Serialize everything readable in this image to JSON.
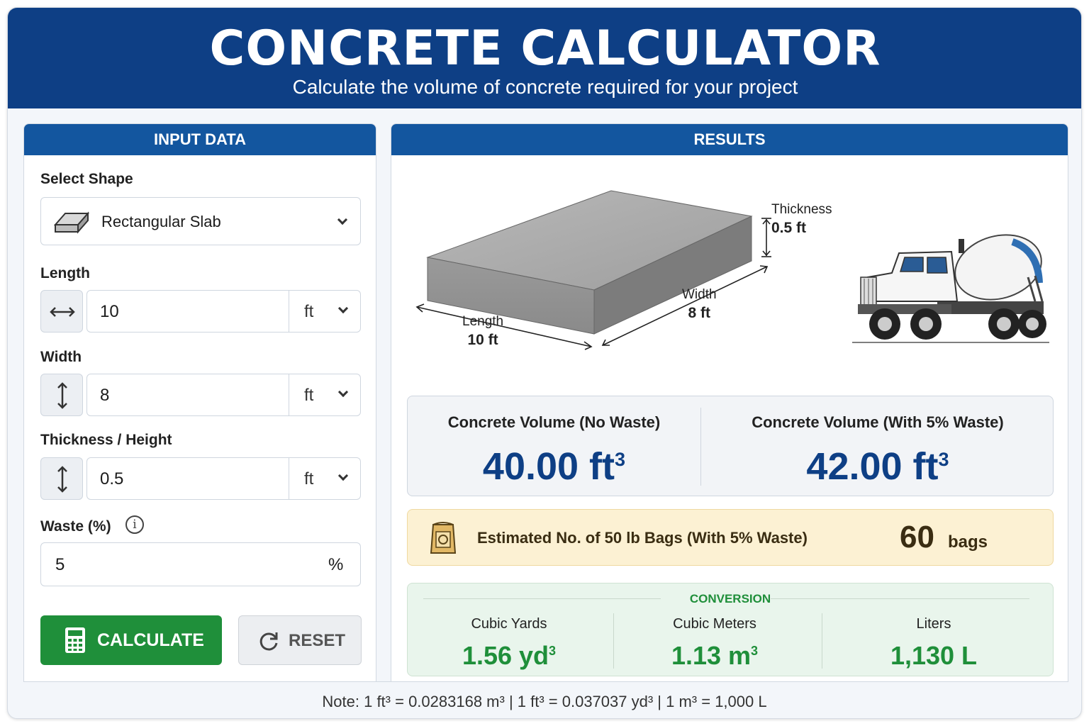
{
  "header": {
    "title": "CONCRETE CALCULATOR",
    "subtitle": "Calculate the volume of concrete required for your project"
  },
  "input_panel": {
    "heading": "INPUT DATA",
    "shape_label": "Select Shape",
    "shape_value": "Rectangular Slab",
    "length": {
      "label": "Length",
      "value": "10",
      "unit": "ft"
    },
    "width": {
      "label": "Width",
      "value": "8",
      "unit": "ft"
    },
    "thickness": {
      "label": "Thickness / Height",
      "value": "0.5",
      "unit": "ft"
    },
    "waste": {
      "label": "Waste (%)",
      "value": "5",
      "unit": "%",
      "info_glyph": "i"
    },
    "calculate_label": "CALCULATE",
    "reset_label": "RESET"
  },
  "results_panel": {
    "heading": "RESULTS",
    "diagram": {
      "thickness_label": "Thickness",
      "thickness_value": "0.5 ft",
      "width_label": "Width",
      "width_value": "8 ft",
      "length_label": "Length",
      "length_value": "10 ft"
    },
    "volume_no_waste": {
      "label": "Concrete Volume (No Waste)",
      "value": "40.00 ft",
      "sup": "3"
    },
    "volume_with_waste": {
      "label": "Concrete Volume (With 5% Waste)",
      "value": "42.00 ft",
      "sup": "3"
    },
    "bags": {
      "label": "Estimated No. of 50 lb Bags (With 5% Waste)",
      "value": "60",
      "unit": "bags"
    },
    "conversion": {
      "title": "CONVERSION",
      "items": [
        {
          "label": "Cubic Yards",
          "value": "1.56 yd",
          "sup": "3"
        },
        {
          "label": "Cubic Meters",
          "value": "1.13 m",
          "sup": "3"
        },
        {
          "label": "Liters",
          "value": "1,130 L",
          "sup": ""
        }
      ]
    }
  },
  "note": "Note: 1 ft³ = 0.0283168 m³  |  1 ft³ = 0.037037 yd³  |  1 m³ = 1,000 L",
  "icons": {
    "shape": "slab-icon",
    "length": "horizontal-arrows-icon",
    "width": "vertical-arrows-icon",
    "thickness": "vertical-arrows-icon",
    "calculate": "calculator-icon",
    "reset": "refresh-icon",
    "bag": "cement-bag-icon",
    "truck": "concrete-mixer-truck-icon"
  },
  "colors": {
    "header": "#0e3f85",
    "panel_head": "#13569f",
    "primary_value": "#0e3f85",
    "calculate_button": "#1f8f3a",
    "conversion_value": "#1f8f3a",
    "bags_bg": "#fcf1d3"
  }
}
